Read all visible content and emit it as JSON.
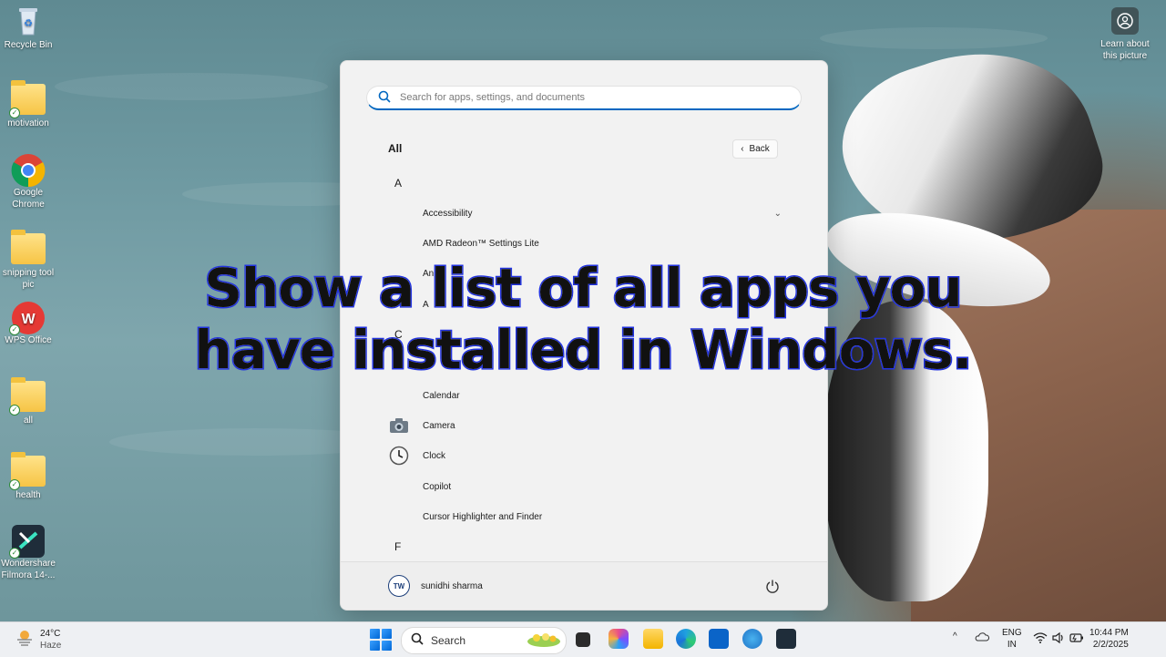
{
  "desktop": {
    "icons": [
      {
        "label": "Recycle Bin",
        "icon": "recycle-bin-icon"
      },
      {
        "label": "motivation",
        "icon": "folder-icon"
      },
      {
        "label": "Google Chrome",
        "icon": "chrome-icon"
      },
      {
        "label": "snipping tool pic",
        "icon": "folder-icon"
      },
      {
        "label": "WPS Office",
        "icon": "wps-office-icon"
      },
      {
        "label": "all",
        "icon": "folder-icon"
      },
      {
        "label": "health",
        "icon": "folder-icon"
      },
      {
        "label": "Wondershare Filmora 14-...",
        "icon": "filmora-icon"
      }
    ],
    "learn_about": "Learn about this picture"
  },
  "start_menu": {
    "search_placeholder": "Search for apps, settings, and documents",
    "section_title": "All",
    "back_label": "Back",
    "groups": [
      {
        "letter": "A",
        "apps": [
          "Accessibility",
          "AMD Radeon™ Settings Lite",
          "An",
          "A"
        ]
      },
      {
        "letter": "C",
        "apps": [
          "Calendar",
          "Camera",
          "Clock",
          "Copilot",
          "Cursor Highlighter and Finder"
        ]
      },
      {
        "letter": "F",
        "apps": []
      }
    ],
    "user_name": "sunidhi sharma",
    "avatar_text": "TW"
  },
  "caption": {
    "line1": "Show a list of all apps you",
    "line2": "have installed in Windows."
  },
  "taskbar": {
    "temperature": "24°C",
    "weather": "Haze",
    "search_label": "Search",
    "language_top": "ENG",
    "language_bottom": "IN",
    "time": "10:44 PM",
    "date": "2/2/2025"
  },
  "colors": {
    "accent": "#0067c0",
    "caption_stroke": "#2233e0"
  }
}
